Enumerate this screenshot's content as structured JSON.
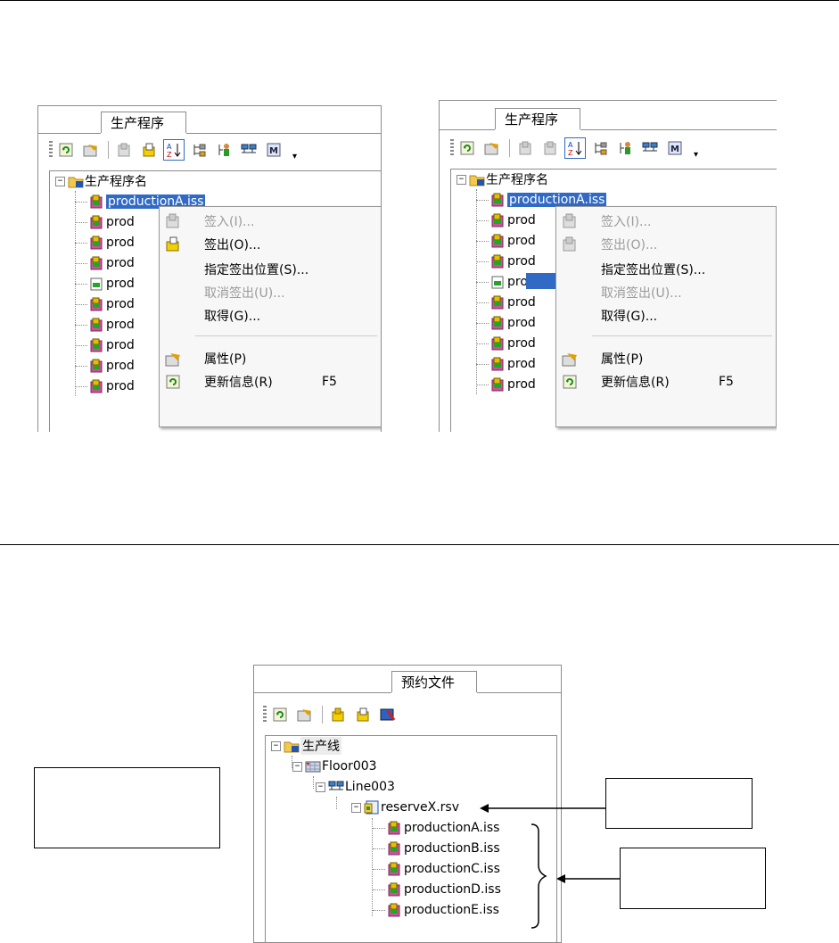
{
  "panel_left": {
    "tab": "生产程序",
    "root": "生产程序名",
    "selected_file": "productionA.iss",
    "items": [
      "prod",
      "prod",
      "prod",
      "prod",
      "prod",
      "prod",
      "prod",
      "prod",
      "prod"
    ],
    "menu": [
      {
        "label": "签入(I)...",
        "disabled": true
      },
      {
        "label": "签出(O)...",
        "disabled": false
      },
      {
        "label": "指定签出位置(S)...",
        "disabled": false
      },
      {
        "label": "取消签出(U)...",
        "disabled": true
      },
      {
        "label": "取得(G)...",
        "disabled": false
      },
      {
        "label": "属性(P)",
        "disabled": false
      },
      {
        "label": "更新信息(R)",
        "shortcut": "F5",
        "disabled": false
      }
    ]
  },
  "panel_right": {
    "tab": "生产程序",
    "root": "生产程序名",
    "selected_file": "productionA.iss",
    "items": [
      "prod",
      "prod",
      "prod",
      "prod",
      "prod",
      "prod",
      "prod",
      "prod",
      "prod"
    ],
    "menu": [
      {
        "label": "签入(I)...",
        "disabled": true
      },
      {
        "label": "签出(O)...",
        "disabled": true
      },
      {
        "label": "指定签出位置(S)...",
        "disabled": false
      },
      {
        "label": "取消签出(U)...",
        "disabled": true
      },
      {
        "label": "取得(G)...",
        "disabled": false
      },
      {
        "label": "属性(P)",
        "disabled": false
      },
      {
        "label": "更新信息(R)",
        "shortcut": "F5",
        "disabled": false
      }
    ]
  },
  "panel_bottom": {
    "tab": "预约文件",
    "root": "生产线",
    "floor": "Floor003",
    "line": "Line003",
    "reserve": "reserveX.rsv",
    "files": [
      "productionA.iss",
      "productionB.iss",
      "productionC.iss",
      "productionD.iss",
      "productionE.iss"
    ]
  },
  "colors": {
    "selection": "#316ac5",
    "disabled_text": "#9a9a9a",
    "border": "#8c8c8c"
  }
}
